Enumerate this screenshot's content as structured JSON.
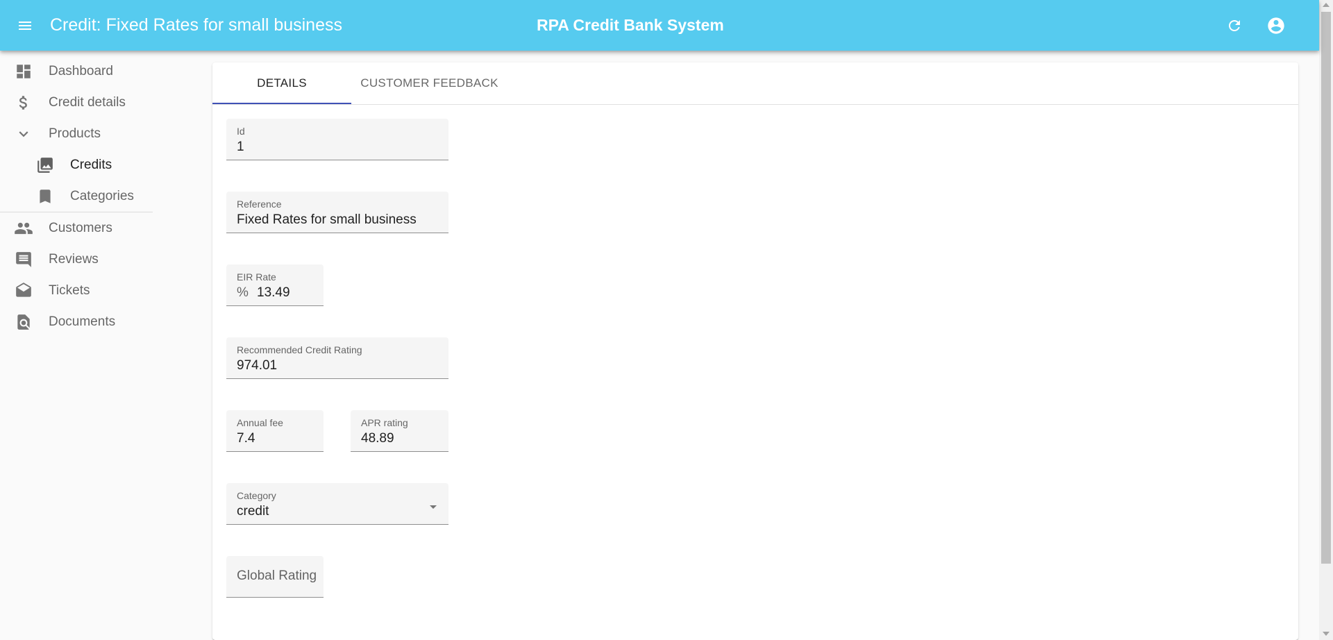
{
  "header": {
    "page_title": "Credit: Fixed Rates for small business",
    "app_name": "RPA Credit Bank System",
    "background_color": "#56cbef"
  },
  "sidebar": {
    "items": [
      {
        "label": "Dashboard",
        "icon": "dashboard-icon"
      },
      {
        "label": "Credit details",
        "icon": "dollar-icon"
      },
      {
        "label": "Products",
        "icon": "chevron-down-icon",
        "expanded": true
      },
      {
        "label": "Credits",
        "icon": "photo-library-icon",
        "active": true
      },
      {
        "label": "Categories",
        "icon": "bookmark-icon"
      },
      {
        "label": "Customers",
        "icon": "people-icon"
      },
      {
        "label": "Reviews",
        "icon": "comment-icon"
      },
      {
        "label": "Tickets",
        "icon": "drafts-icon"
      },
      {
        "label": "Documents",
        "icon": "find-in-page-icon"
      }
    ]
  },
  "tabs": [
    {
      "label": "DETAILS",
      "active": true
    },
    {
      "label": "CUSTOMER FEEDBACK",
      "active": false
    }
  ],
  "form": {
    "id": {
      "label": "Id",
      "value": "1"
    },
    "reference": {
      "label": "Reference",
      "value": "Fixed Rates for small business"
    },
    "eir_rate": {
      "label": "EIR Rate",
      "prefix": "%",
      "value": "13.49"
    },
    "recommended_credit_rating": {
      "label": "Recommended Credit Rating",
      "value": "974.01"
    },
    "annual_fee": {
      "label": "Annual fee",
      "value": "7.4"
    },
    "apr_rating": {
      "label": "APR rating",
      "value": "48.89"
    },
    "category": {
      "label": "Category",
      "value": "credit"
    },
    "global_rating": {
      "label": "Global Rating"
    }
  },
  "accent_color": "#3f51b5"
}
